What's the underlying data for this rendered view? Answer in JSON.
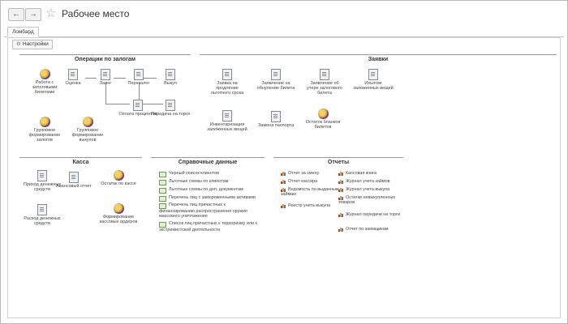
{
  "window": {
    "title": "Рабочее место",
    "tab": "Ломбард",
    "settings_label": "Настройки"
  },
  "sections": {
    "operations": {
      "title": "Операции по залогам",
      "items": [
        "Работа с залоговыми билетами",
        "Оценка",
        "Залог",
        "Перезалог",
        "Выкуп",
        "Оплата процентов",
        "Передача на торги",
        "Групповое формирование залогов",
        "Групповое формирование выкупов"
      ]
    },
    "requests": {
      "title": "Заявки",
      "items": [
        "Заявка на продление льготного срока",
        "Заявление на обнуление билета",
        "Заявление об утере залогового билета",
        "Изъятие заложенных вещей",
        "Инвентаризация заложенных вещей",
        "Замена паспорта",
        "Остаток бланков билетов"
      ]
    },
    "cash": {
      "title": "Касса",
      "items": [
        "Приход денежных средств",
        "Авансовый отчет",
        "Остаток по кассе",
        "Расход денежных средств",
        "Формирование кассовых ордеров"
      ]
    },
    "reference": {
      "title": "Справочные данные",
      "items": [
        "Черный список клиентов",
        "Льготные схемы по клиентам",
        "Льготные схемы по доп. документам",
        "Перечень лиц с замороженными активами",
        "Перечень лиц причастных к финансированию распространения оружия массового уничтожения",
        "Список лиц причастных к терроризму или к экстремистской деятельности"
      ]
    },
    "reports": {
      "title": "Отчеты",
      "left": [
        "Отчет за смену",
        "Отчет кассира",
        "Ведомость по выданным займам",
        "Реестр учета выкупа"
      ],
      "right": [
        "Кассовая книга",
        "Журнал учета займов",
        "Журнал учета выкупа",
        "Остатки невыкупленных товаров",
        "Журнал передачи на торги",
        "Отчет по заемщикам"
      ]
    }
  },
  "icons": {
    "back": "arrow-left-icon",
    "forward": "arrow-right-icon",
    "favorite": "star-icon",
    "settings": "gear-icon",
    "document": "document-icon",
    "coins": "coins-icon",
    "table": "table-icon",
    "report": "bar-chart-icon"
  }
}
